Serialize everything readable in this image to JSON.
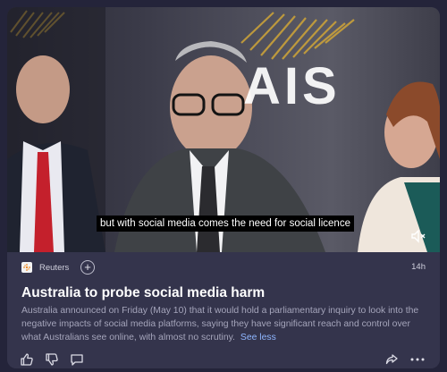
{
  "video": {
    "caption": "but with social media comes the need for social licence",
    "background_text": "AIS"
  },
  "meta": {
    "source": "Reuters",
    "time": "14h"
  },
  "article": {
    "headline": "Australia to probe social media harm",
    "summary": "Australia announced on Friday (May 10) that it would hold a parliamentary inquiry to look into the negative impacts of social media platforms, saying they have significant reach and control over what Australians see online, with almost no scrutiny.",
    "see_less": "See less"
  },
  "icons": {
    "like": "thumbs-up-icon",
    "dislike": "thumbs-down-icon",
    "comment": "comment-icon",
    "share": "share-icon",
    "more": "more-icon",
    "mute": "mute-icon",
    "follow": "plus-icon"
  },
  "colors": {
    "card_bg": "#34344c",
    "page_bg": "#24243a",
    "link": "#8fb6ff",
    "logo_gold": "#c9a13a"
  }
}
